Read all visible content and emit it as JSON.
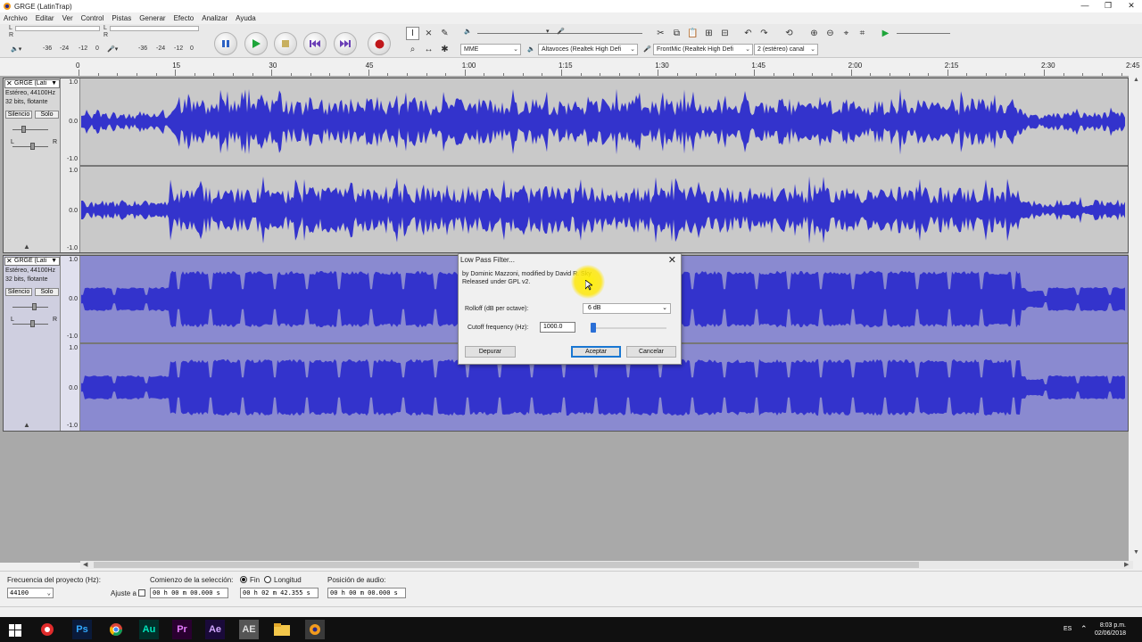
{
  "window": {
    "title": "GRGE (LatinTrap)",
    "controls": [
      "—",
      "❐",
      "✕"
    ]
  },
  "menu": [
    "Archivo",
    "Editar",
    "Ver",
    "Control",
    "Pistas",
    "Generar",
    "Efecto",
    "Analizar",
    "Ayuda"
  ],
  "meter": {
    "rec_scale": [
      "-36",
      "-24",
      "-12",
      "0"
    ],
    "play_scale": [
      "-36",
      "-24",
      "-12",
      "0"
    ],
    "lr": [
      "L",
      "R"
    ]
  },
  "devices": {
    "host": "MME",
    "output": "Altavoces (Realtek High Defi",
    "input": "FrontMic (Realtek High Defi",
    "channels": "2 (estéreo) canal"
  },
  "ruler": {
    "labels": [
      "0",
      "15",
      "30",
      "45",
      "1:00",
      "1:15",
      "1:30",
      "1:45",
      "2:00",
      "2:15",
      "2:30",
      "2:45"
    ]
  },
  "tracks": [
    {
      "name": "GRGE (Lati",
      "info1": "Estéreo, 44100Hz",
      "info2": "32 bits, flotante",
      "mute": "Silencio",
      "solo": "Solo",
      "pan_l": "L",
      "pan_r": "R",
      "scale": [
        "1.0",
        "0.0",
        "-1.0"
      ]
    },
    {
      "name": "GRGE (Lati",
      "info1": "Estéreo, 44100Hz",
      "info2": "32 bits, flotante",
      "mute": "Silencio",
      "solo": "Solo",
      "pan_l": "L",
      "pan_r": "R",
      "scale": [
        "1.0",
        "0.0",
        "-1.0"
      ]
    }
  ],
  "colors": {
    "waveform": "#3333cc",
    "selected_bg": "#8a8ad0",
    "track_bg": "#c9c9c9"
  },
  "dialog": {
    "title": "Low Pass Filter...",
    "author_line1": "by Dominic Mazzoni, modified by David R. Sky",
    "author_line2": "Released under GPL v2.",
    "rolloff_label": "Rolloff (dB per octave):",
    "rolloff_value": "6 dB",
    "cutoff_label": "Cutoff frequency (Hz):",
    "cutoff_value": "1000.0",
    "debug_button": "Depurar",
    "ok_button": "Aceptar",
    "cancel_button": "Cancelar"
  },
  "selection_bar": {
    "rate_label": "Frecuencia del proyecto (Hz):",
    "rate_value": "44100",
    "snap_label": "Ajuste a",
    "start_label": "Comienzo de la selección:",
    "end_option": "Fin",
    "length_option": "Longitud",
    "start_value": "00 h 00 m 00.000 s",
    "end_value": "00 h 02 m 42.355 s",
    "position_label": "Posición de audio:",
    "position_value": "00 h 00 m 00.000 s"
  },
  "taskbar": {
    "lang": "ES",
    "time": "8:03 p.m.",
    "date": "02/06/2018",
    "apps": [
      "Ps",
      "Au",
      "Pr",
      "Ae",
      "AE"
    ]
  }
}
